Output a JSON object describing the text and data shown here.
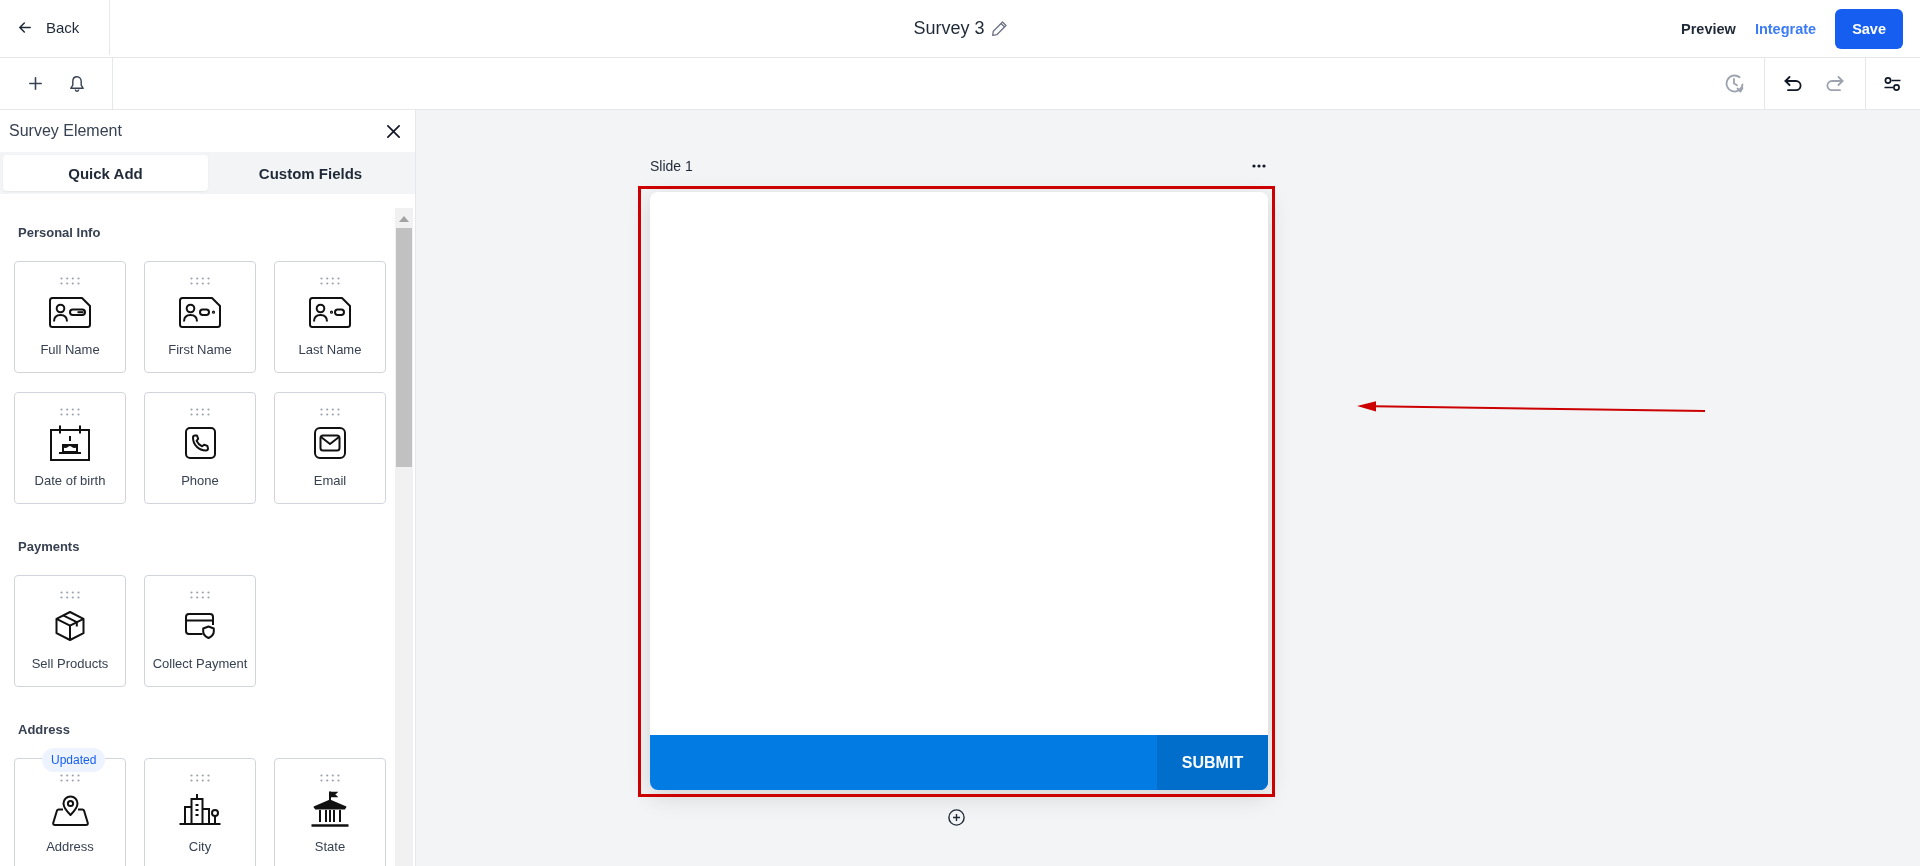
{
  "header": {
    "back": "Back",
    "title": "Survey 3",
    "actions": [
      {
        "label": "Preview",
        "kind": "plain"
      },
      {
        "label": "Integrate",
        "kind": "link"
      },
      {
        "label": "Save",
        "kind": "primary"
      }
    ]
  },
  "toolbar": {
    "history": {
      "disabled": true
    },
    "undo": {
      "disabled": false
    },
    "redo": {
      "disabled": true
    }
  },
  "sidebar": {
    "title": "Survey Element",
    "tabs": [
      {
        "label": "Quick Add",
        "selected": true
      },
      {
        "label": "Custom Fields",
        "selected": false
      }
    ],
    "sections": [
      {
        "title": "Personal Info",
        "items": [
          {
            "label": "Full Name",
            "kind": "full-name"
          },
          {
            "label": "First Name",
            "kind": "first-name"
          },
          {
            "label": "Last Name",
            "kind": "last-name"
          },
          {
            "label": "Date of birth",
            "kind": "date"
          },
          {
            "label": "Phone",
            "kind": "phone"
          },
          {
            "label": "Email",
            "kind": "email"
          }
        ]
      },
      {
        "title": "Payments",
        "items": [
          {
            "label": "Sell Products",
            "kind": "products"
          },
          {
            "label": "Collect Payment",
            "kind": "payment"
          }
        ]
      },
      {
        "title": "Address",
        "items": [
          {
            "label": "Address",
            "kind": "address",
            "badge": "Updated"
          },
          {
            "label": "City",
            "kind": "city"
          },
          {
            "label": "State",
            "kind": "state"
          }
        ]
      }
    ]
  },
  "slide": {
    "title": "Slide 1",
    "submit": "SUBMIT"
  },
  "annotations": {
    "highlight_frame": true,
    "pointer_arrow": true
  }
}
